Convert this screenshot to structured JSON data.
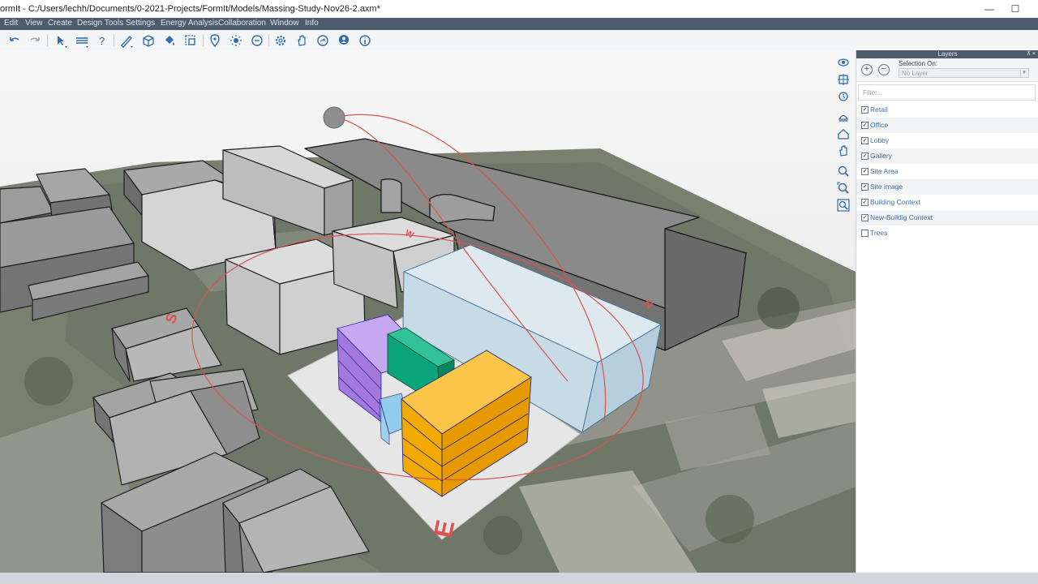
{
  "window": {
    "title": "ormIt  - C:/Users/lechh/Documents/0-2021-Projects/FormIt/Models/Massing-Study-Nov26-2.axm*",
    "minimize_glyph": "—",
    "maximize_glyph": "☐"
  },
  "menu": {
    "items": [
      "Edit",
      "View",
      "Create",
      "Design Tools",
      "Settings",
      "Energy Analysis",
      "Collaboration",
      "Window",
      "Info"
    ]
  },
  "toolbar": {
    "icons": [
      "undo-icon",
      "redo-icon",
      "select-icon",
      "level-icon",
      "help-icon",
      "sketch-icon",
      "shape-icon",
      "paint-icon",
      "group-icon",
      "location-icon",
      "sun-icon",
      "visual-style-icon",
      "settings-icon",
      "hand-icon",
      "share-icon",
      "account-icon",
      "info-icon"
    ]
  },
  "viewport": {
    "compass_labels": {
      "south": "S",
      "west": "W",
      "north": "N",
      "east": "E"
    },
    "sun_path_color": "#d9534f",
    "nav_icons": [
      "orbit-icon",
      "pan-icon",
      "look-around-icon",
      "views-icon",
      "home-view-icon",
      "camera-icon",
      "zoom-icon",
      "zoom-extents-icon",
      "zoom-selection-icon"
    ]
  },
  "layers_panel": {
    "header": "Layers",
    "pin_glyphs": "⊼ ×",
    "add_glyph": "+",
    "remove_glyph": "−",
    "selection_on_label": "Selection On:",
    "selection_value": "No Layer",
    "filter_placeholder": "Filter...",
    "layers": [
      {
        "name": "Retail",
        "checked": true
      },
      {
        "name": "Office",
        "checked": true
      },
      {
        "name": "Lobby",
        "checked": true
      },
      {
        "name": "Gallery",
        "checked": true
      },
      {
        "name": "Site Area",
        "checked": true
      },
      {
        "name": "Site image",
        "checked": true
      },
      {
        "name": "Building Context",
        "checked": true
      },
      {
        "name": "New-Buildig Context",
        "checked": true
      },
      {
        "name": "Trees",
        "checked": false
      }
    ]
  },
  "colors": {
    "menubar": "#4d5b6c",
    "office_mass": "#c6dbe6",
    "retail_mass": "#f2a900",
    "lobby_mass": "#9f6bd8",
    "gallery_mass": "#0aa57a",
    "context_mass": "#8b8b8b"
  }
}
